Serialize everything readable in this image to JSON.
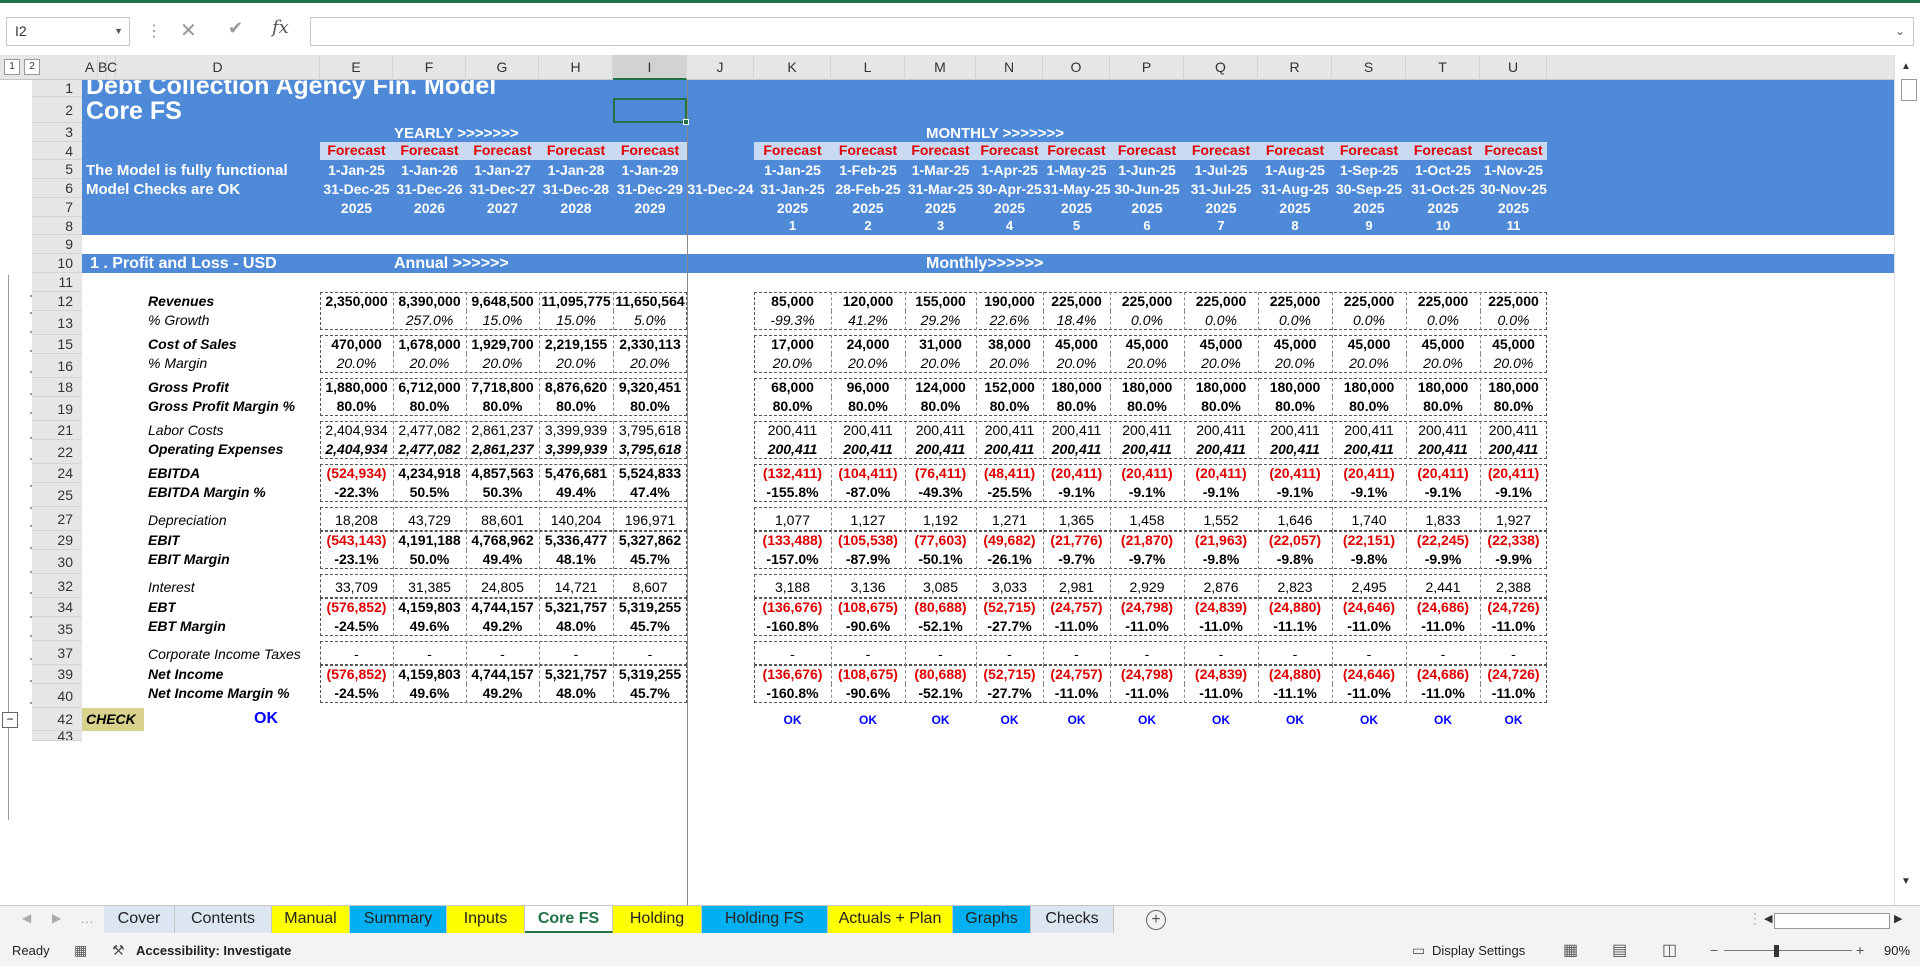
{
  "formula_bar": {
    "name_box": "I2",
    "fx": "fx",
    "formula": ""
  },
  "outline_levels": [
    "1",
    "2"
  ],
  "columns": [
    "A",
    "B",
    "C",
    "D",
    "E",
    "F",
    "G",
    "H",
    "I",
    "J",
    "K",
    "L",
    "M",
    "N",
    "O",
    "P",
    "Q",
    "R",
    "S",
    "T",
    "U"
  ],
  "rows": [
    "1",
    "2",
    "3",
    "4",
    "5",
    "6",
    "7",
    "8",
    "9",
    "10",
    "11",
    "12",
    "13",
    "15",
    "16",
    "18",
    "19",
    "21",
    "22",
    "24",
    "25",
    "27",
    "29",
    "30",
    "32",
    "34",
    "35",
    "37",
    "39",
    "40",
    "42",
    "43"
  ],
  "header": {
    "title1": "Debt Collection Agency Fin. Model",
    "title2": "Core FS",
    "yearly": "YEARLY >>>>>>>",
    "monthly": "MONTHLY >>>>>>>",
    "functional": "The Model is fully functional",
    "checks_ok": "Model Checks are OK",
    "j_date": "31-Dec-24",
    "forecast": "Forecast"
  },
  "yearly_cols": [
    {
      "start": "1-Jan-25",
      "end": "31-Dec-25",
      "year": "2025"
    },
    {
      "start": "1-Jan-26",
      "end": "31-Dec-26",
      "year": "2026"
    },
    {
      "start": "1-Jan-27",
      "end": "31-Dec-27",
      "year": "2027"
    },
    {
      "start": "1-Jan-28",
      "end": "31-Dec-28",
      "year": "2028"
    },
    {
      "start": "1-Jan-29",
      "end": "31-Dec-29",
      "year": "2029"
    }
  ],
  "monthly_cols": [
    {
      "start": "1-Jan-25",
      "end": "31-Jan-25",
      "year": "2025",
      "n": "1"
    },
    {
      "start": "1-Feb-25",
      "end": "28-Feb-25",
      "year": "2025",
      "n": "2"
    },
    {
      "start": "1-Mar-25",
      "end": "31-Mar-25",
      "year": "2025",
      "n": "3"
    },
    {
      "start": "1-Apr-25",
      "end": "30-Apr-25",
      "year": "2025",
      "n": "4"
    },
    {
      "start": "1-May-25",
      "end": "31-May-25",
      "year": "2025",
      "n": "5"
    },
    {
      "start": "1-Jun-25",
      "end": "30-Jun-25",
      "year": "2025",
      "n": "6"
    },
    {
      "start": "1-Jul-25",
      "end": "31-Jul-25",
      "year": "2025",
      "n": "7"
    },
    {
      "start": "1-Aug-25",
      "end": "31-Aug-25",
      "year": "2025",
      "n": "8"
    },
    {
      "start": "1-Sep-25",
      "end": "30-Sep-25",
      "year": "2025",
      "n": "9"
    },
    {
      "start": "1-Oct-25",
      "end": "31-Oct-25",
      "year": "2025",
      "n": "10"
    },
    {
      "start": "1-Nov-25",
      "end": "30-Nov-25",
      "year": "2025",
      "n": "11"
    }
  ],
  "section": {
    "title": "1 . Profit and Loss - USD",
    "annual": "Annual >>>>>>",
    "monthly": "Monthly>>>>>>"
  },
  "pl_rows": [
    {
      "label": "Revenues",
      "style": "lb",
      "vals": "b",
      "yearly": [
        "2,350,000",
        "8,390,000",
        "9,648,500",
        "11,095,775",
        "11,650,564"
      ],
      "monthly": [
        "85,000",
        "120,000",
        "155,000",
        "190,000",
        "225,000",
        "225,000",
        "225,000",
        "225,000",
        "225,000",
        "225,000",
        "225,000"
      ]
    },
    {
      "label": "% Growth",
      "style": "li",
      "vals": "i",
      "yearly": [
        "",
        "257.0%",
        "15.0%",
        "15.0%",
        "5.0%"
      ],
      "monthly": [
        "-99.3%",
        "41.2%",
        "29.2%",
        "22.6%",
        "18.4%",
        "0.0%",
        "0.0%",
        "0.0%",
        "0.0%",
        "0.0%",
        "0.0%"
      ]
    },
    {
      "label": "Cost of Sales",
      "style": "lb",
      "vals": "b",
      "yearly": [
        "470,000",
        "1,678,000",
        "1,929,700",
        "2,219,155",
        "2,330,113"
      ],
      "monthly": [
        "17,000",
        "24,000",
        "31,000",
        "38,000",
        "45,000",
        "45,000",
        "45,000",
        "45,000",
        "45,000",
        "45,000",
        "45,000"
      ]
    },
    {
      "label": "% Margin",
      "style": "li",
      "vals": "i",
      "yearly": [
        "20.0%",
        "20.0%",
        "20.0%",
        "20.0%",
        "20.0%"
      ],
      "monthly": [
        "20.0%",
        "20.0%",
        "20.0%",
        "20.0%",
        "20.0%",
        "20.0%",
        "20.0%",
        "20.0%",
        "20.0%",
        "20.0%",
        "20.0%"
      ]
    },
    {
      "label": "Gross Profit",
      "style": "lb",
      "vals": "b",
      "yearly": [
        "1,880,000",
        "6,712,000",
        "7,718,800",
        "8,876,620",
        "9,320,451"
      ],
      "monthly": [
        "68,000",
        "96,000",
        "124,000",
        "152,000",
        "180,000",
        "180,000",
        "180,000",
        "180,000",
        "180,000",
        "180,000",
        "180,000"
      ]
    },
    {
      "label": "Gross Profit Margin %",
      "style": "lb",
      "vals": "b",
      "yearly": [
        "80.0%",
        "80.0%",
        "80.0%",
        "80.0%",
        "80.0%"
      ],
      "monthly": [
        "80.0%",
        "80.0%",
        "80.0%",
        "80.0%",
        "80.0%",
        "80.0%",
        "80.0%",
        "80.0%",
        "80.0%",
        "80.0%",
        "80.0%"
      ]
    },
    {
      "label": "Labor Costs",
      "style": "li",
      "vals": "n",
      "yearly": [
        "2,404,934",
        "2,477,082",
        "2,861,237",
        "3,399,939",
        "3,795,618"
      ],
      "monthly": [
        "200,411",
        "200,411",
        "200,411",
        "200,411",
        "200,411",
        "200,411",
        "200,411",
        "200,411",
        "200,411",
        "200,411",
        "200,411"
      ]
    },
    {
      "label": "Operating Expenses",
      "style": "lb",
      "vals": "bi",
      "yearly": [
        "2,404,934",
        "2,477,082",
        "2,861,237",
        "3,399,939",
        "3,795,618"
      ],
      "monthly": [
        "200,411",
        "200,411",
        "200,411",
        "200,411",
        "200,411",
        "200,411",
        "200,411",
        "200,411",
        "200,411",
        "200,411",
        "200,411"
      ]
    },
    {
      "label": "EBITDA",
      "style": "lb",
      "vals": "b",
      "yearly": [
        "(524,934)",
        "4,234,918",
        "4,857,563",
        "5,476,681",
        "5,524,833"
      ],
      "monthly": [
        "(132,411)",
        "(104,411)",
        "(76,411)",
        "(48,411)",
        "(20,411)",
        "(20,411)",
        "(20,411)",
        "(20,411)",
        "(20,411)",
        "(20,411)",
        "(20,411)"
      ]
    },
    {
      "label": "EBITDA Margin %",
      "style": "lb",
      "vals": "b",
      "yearly": [
        "-22.3%",
        "50.5%",
        "50.3%",
        "49.4%",
        "47.4%"
      ],
      "monthly": [
        "-155.8%",
        "-87.0%",
        "-49.3%",
        "-25.5%",
        "-9.1%",
        "-9.1%",
        "-9.1%",
        "-9.1%",
        "-9.1%",
        "-9.1%",
        "-9.1%"
      ]
    },
    {
      "label": "Depreciation",
      "style": "li",
      "vals": "n",
      "yearly": [
        "18,208",
        "43,729",
        "88,601",
        "140,204",
        "196,971"
      ],
      "monthly": [
        "1,077",
        "1,127",
        "1,192",
        "1,271",
        "1,365",
        "1,458",
        "1,552",
        "1,646",
        "1,740",
        "1,833",
        "1,927"
      ]
    },
    {
      "label": "EBIT",
      "style": "lb",
      "vals": "b",
      "yearly": [
        "(543,143)",
        "4,191,188",
        "4,768,962",
        "5,336,477",
        "5,327,862"
      ],
      "monthly": [
        "(133,488)",
        "(105,538)",
        "(77,603)",
        "(49,682)",
        "(21,776)",
        "(21,870)",
        "(21,963)",
        "(22,057)",
        "(22,151)",
        "(22,245)",
        "(22,338)"
      ]
    },
    {
      "label": "EBIT Margin",
      "style": "lb",
      "vals": "b",
      "yearly": [
        "-23.1%",
        "50.0%",
        "49.4%",
        "48.1%",
        "45.7%"
      ],
      "monthly": [
        "-157.0%",
        "-87.9%",
        "-50.1%",
        "-26.1%",
        "-9.7%",
        "-9.7%",
        "-9.8%",
        "-9.8%",
        "-9.8%",
        "-9.9%",
        "-9.9%"
      ]
    },
    {
      "label": "Interest",
      "style": "li",
      "vals": "n",
      "yearly": [
        "33,709",
        "31,385",
        "24,805",
        "14,721",
        "8,607"
      ],
      "monthly": [
        "3,188",
        "3,136",
        "3,085",
        "3,033",
        "2,981",
        "2,929",
        "2,876",
        "2,823",
        "2,495",
        "2,441",
        "2,388"
      ]
    },
    {
      "label": "EBT",
      "style": "lb",
      "vals": "b",
      "yearly": [
        "(576,852)",
        "4,159,803",
        "4,744,157",
        "5,321,757",
        "5,319,255"
      ],
      "monthly": [
        "(136,676)",
        "(108,675)",
        "(80,688)",
        "(52,715)",
        "(24,757)",
        "(24,798)",
        "(24,839)",
        "(24,880)",
        "(24,646)",
        "(24,686)",
        "(24,726)"
      ]
    },
    {
      "label": "EBT Margin",
      "style": "lb",
      "vals": "b",
      "yearly": [
        "-24.5%",
        "49.6%",
        "49.2%",
        "48.0%",
        "45.7%"
      ],
      "monthly": [
        "-160.8%",
        "-90.6%",
        "-52.1%",
        "-27.7%",
        "-11.0%",
        "-11.0%",
        "-11.0%",
        "-11.1%",
        "-11.0%",
        "-11.0%",
        "-11.0%"
      ]
    },
    {
      "label": "Corporate Income Taxes",
      "style": "li",
      "vals": "n",
      "yearly": [
        "-",
        "-",
        "-",
        "-",
        "-"
      ],
      "monthly": [
        "-",
        "-",
        "-",
        "-",
        "-",
        "-",
        "-",
        "-",
        "-",
        "-",
        "-"
      ]
    },
    {
      "label": "Net Income",
      "style": "lb",
      "vals": "b",
      "yearly": [
        "(576,852)",
        "4,159,803",
        "4,744,157",
        "5,321,757",
        "5,319,255"
      ],
      "monthly": [
        "(136,676)",
        "(108,675)",
        "(80,688)",
        "(52,715)",
        "(24,757)",
        "(24,798)",
        "(24,839)",
        "(24,880)",
        "(24,646)",
        "(24,686)",
        "(24,726)"
      ]
    },
    {
      "label": "Net Income Margin %",
      "style": "lb",
      "vals": "b",
      "yearly": [
        "-24.5%",
        "49.6%",
        "49.2%",
        "48.0%",
        "45.7%"
      ],
      "monthly": [
        "-160.8%",
        "-90.6%",
        "-52.1%",
        "-27.7%",
        "-11.0%",
        "-11.0%",
        "-11.0%",
        "-11.1%",
        "-11.0%",
        "-11.0%",
        "-11.0%"
      ]
    }
  ],
  "check": {
    "label": "CHECK",
    "value": "OK",
    "monthly": "OK"
  },
  "tabs": [
    {
      "label": "Cover",
      "color": "#dce6f1"
    },
    {
      "label": "Contents",
      "color": "#dce6f1"
    },
    {
      "label": "Manual",
      "color": "#ffff00"
    },
    {
      "label": "Summary",
      "color": "#00b0f0"
    },
    {
      "label": "Inputs",
      "color": "#ffff00"
    },
    {
      "label": "Core FS",
      "color": "#ffffff"
    },
    {
      "label": "Holding",
      "color": "#ffff00"
    },
    {
      "label": "Holding FS",
      "color": "#00b0f0"
    },
    {
      "label": "Actuals + Plan",
      "color": "#ffff00"
    },
    {
      "label": "Graphs",
      "color": "#00b0f0"
    },
    {
      "label": "Checks",
      "color": "#dce6f1"
    }
  ],
  "status": {
    "ready": "Ready",
    "accessibility": "Accessibility: Investigate",
    "display": "Display Settings",
    "zoom": "90%"
  },
  "colors": {
    "band": "#4f8ad8",
    "accent": "#217346",
    "negative": "#e00000"
  }
}
